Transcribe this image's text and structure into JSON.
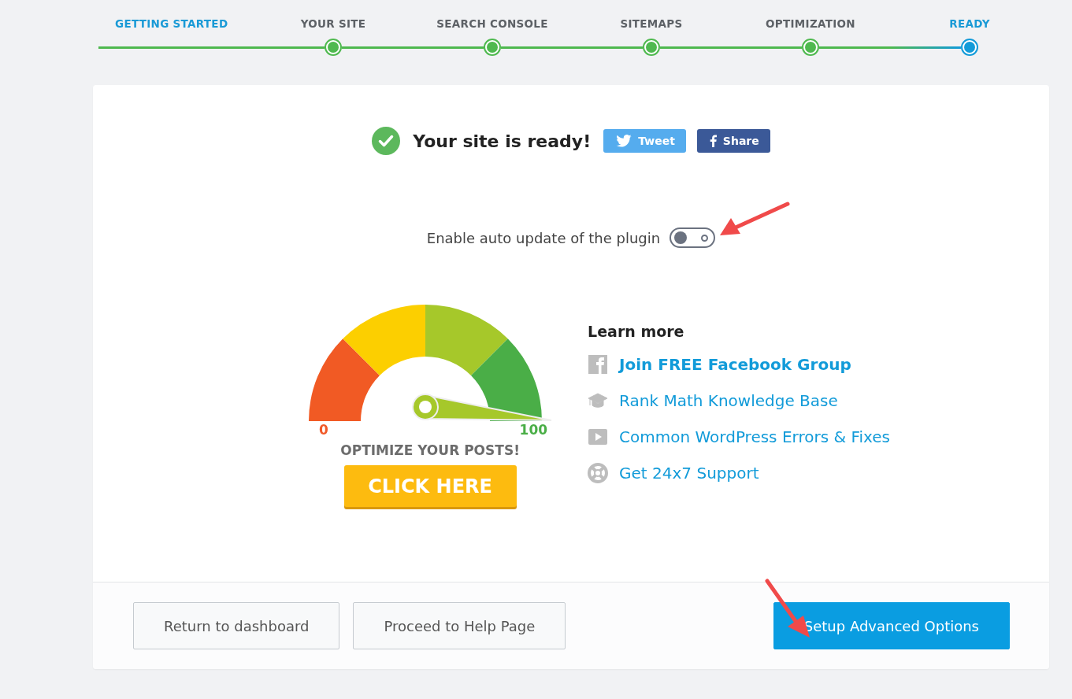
{
  "steps": [
    {
      "label": "GETTING STARTED",
      "kind": "start"
    },
    {
      "label": "YOUR SITE",
      "kind": "done"
    },
    {
      "label": "SEARCH CONSOLE",
      "kind": "done"
    },
    {
      "label": "SITEMAPS",
      "kind": "done"
    },
    {
      "label": "OPTIMIZATION",
      "kind": "done"
    },
    {
      "label": "READY",
      "kind": "current"
    }
  ],
  "heading": {
    "title": "Your site is ready!",
    "share_buttons": [
      {
        "label": "Tweet",
        "kind": "twitter"
      },
      {
        "label": "Share",
        "kind": "facebook"
      }
    ]
  },
  "auto_update": {
    "label": "Enable auto update of the plugin",
    "on": false
  },
  "promo": {
    "min_label": "0",
    "max_label": "100",
    "caption": "OPTIMIZE YOUR POSTS!",
    "button": "CLICK HERE"
  },
  "learn_more": {
    "title": "Learn more",
    "links": [
      {
        "label": "Join FREE Facebook Group",
        "kind": "facebook"
      },
      {
        "label": "Rank Math Knowledge Base",
        "kind": "knowledge"
      },
      {
        "label": "Common WordPress Errors & Fixes",
        "kind": "video"
      },
      {
        "label": "Get 24x7 Support",
        "kind": "support"
      }
    ]
  },
  "footer": {
    "buttons": [
      {
        "label": "Return to dashboard",
        "kind": "secondary"
      },
      {
        "label": "Proceed to Help Page",
        "kind": "secondary"
      },
      {
        "label": "Setup Advanced Options",
        "kind": "primary"
      }
    ]
  }
}
